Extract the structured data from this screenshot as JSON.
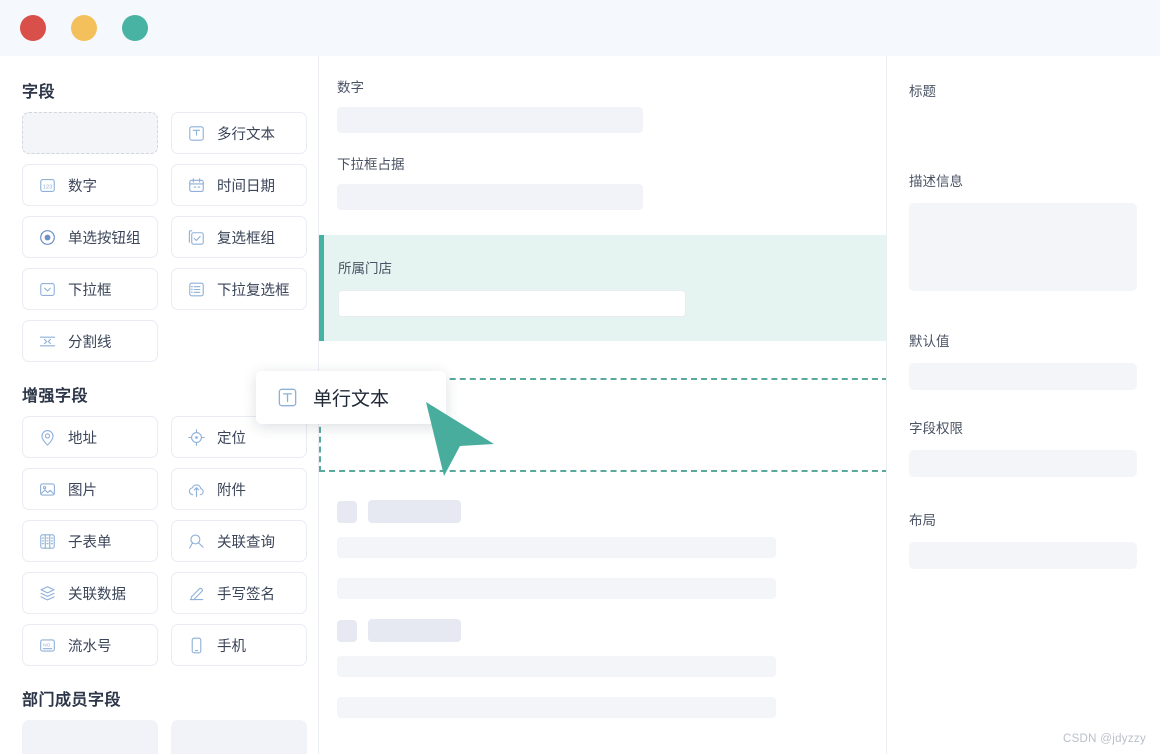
{
  "window": {
    "controls": [
      {
        "name": "close",
        "color": "#d94f4a"
      },
      {
        "name": "minimize",
        "color": "#f3c05c"
      },
      {
        "name": "maximize",
        "color": "#49b3a3"
      }
    ]
  },
  "sidebar": {
    "sections": [
      {
        "title": "字段",
        "items": [
          {
            "label": "",
            "icon": "placeholder-ghost",
            "ghost": true
          },
          {
            "label": "多行文本",
            "icon": "multiline-text-icon"
          },
          {
            "label": "数字",
            "icon": "number-icon"
          },
          {
            "label": "时间日期",
            "icon": "calendar-icon"
          },
          {
            "label": "单选按钮组",
            "icon": "radio-group-icon"
          },
          {
            "label": "复选框组",
            "icon": "checkbox-group-icon"
          },
          {
            "label": "下拉框",
            "icon": "dropdown-icon"
          },
          {
            "label": "下拉复选框",
            "icon": "dropdown-multiselect-icon"
          },
          {
            "label": "分割线",
            "icon": "divider-icon"
          }
        ]
      },
      {
        "title": "增强字段",
        "items": [
          {
            "label": "地址",
            "icon": "location-pin-icon"
          },
          {
            "label": "定位",
            "icon": "gps-target-icon"
          },
          {
            "label": "图片",
            "icon": "image-icon"
          },
          {
            "label": "附件",
            "icon": "upload-cloud-icon"
          },
          {
            "label": "子表单",
            "icon": "subform-icon"
          },
          {
            "label": "关联查询",
            "icon": "relation-search-icon"
          },
          {
            "label": "关联数据",
            "icon": "relation-data-icon"
          },
          {
            "label": "手写签名",
            "icon": "signature-pen-icon"
          },
          {
            "label": "流水号",
            "icon": "serial-number-icon"
          },
          {
            "label": "手机",
            "icon": "mobile-phone-icon"
          }
        ]
      },
      {
        "title": "部门成员字段",
        "items": [
          {
            "label": "",
            "icon": "skeleton",
            "skeleton": true
          },
          {
            "label": "",
            "icon": "skeleton",
            "skeleton": true
          }
        ]
      }
    ]
  },
  "canvas": {
    "fields": [
      {
        "label": "数字"
      },
      {
        "label": "下拉框占据"
      }
    ],
    "selected_field": {
      "label": "所属门店",
      "accent": "#44b3a3",
      "background": "#e6f4f1"
    },
    "dropzone": {
      "border_color": "#5aa99c"
    }
  },
  "drag": {
    "label": "单行文本",
    "icon": "single-line-text-icon",
    "cursor_color": "#49ad9d"
  },
  "properties": {
    "fields": [
      {
        "label": "标题",
        "type": "input",
        "height": 0
      },
      {
        "label": "描述信息",
        "type": "textarea",
        "height": 88
      },
      {
        "label": "默认值",
        "type": "input",
        "height": 27
      },
      {
        "label": "字段权限",
        "type": "input",
        "height": 27
      },
      {
        "label": "布局",
        "type": "input",
        "height": 27
      }
    ]
  },
  "watermark": "CSDN @jdyzzy"
}
